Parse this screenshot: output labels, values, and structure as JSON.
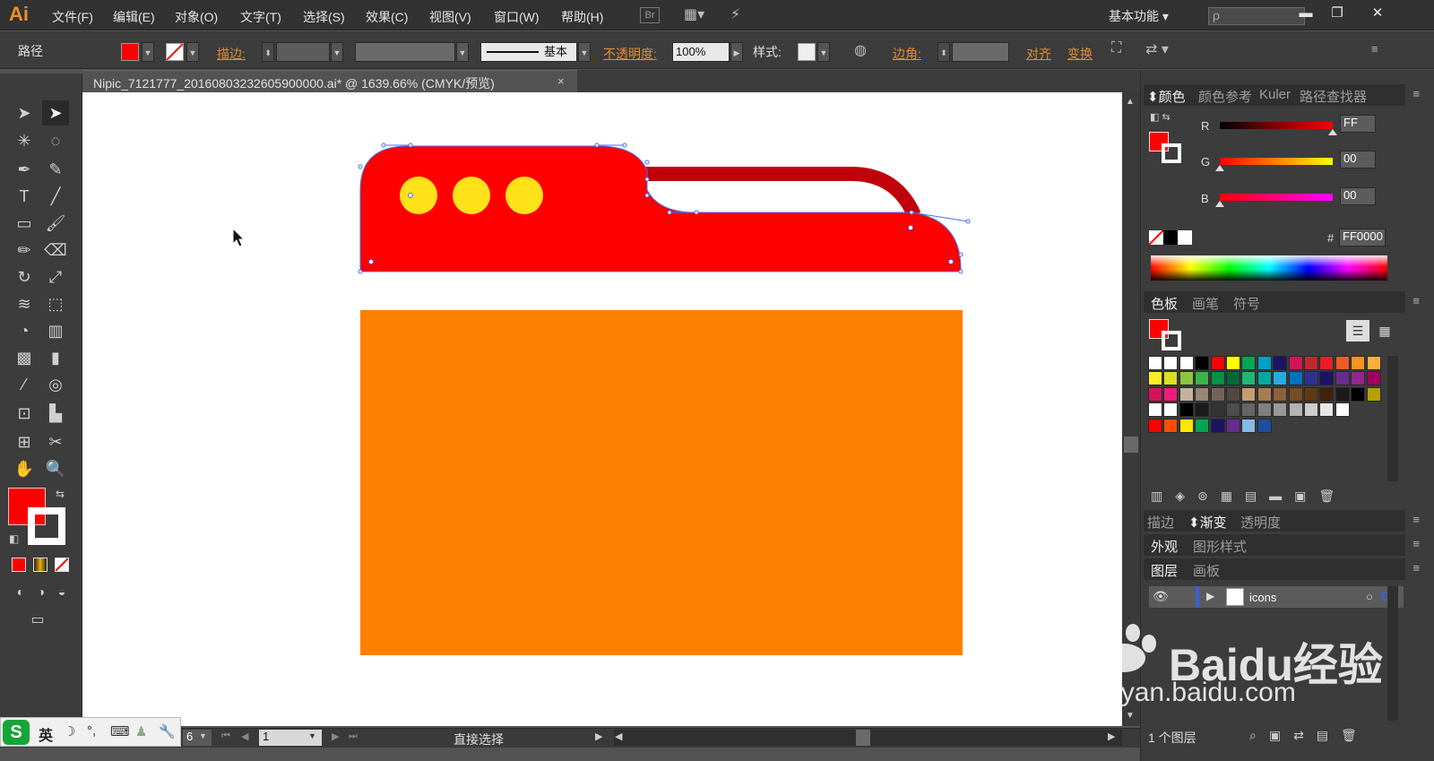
{
  "menubar": {
    "logo": "Ai",
    "items": [
      "文件(F)",
      "编辑(E)",
      "对象(O)",
      "文字(T)",
      "选择(S)",
      "效果(C)",
      "视图(V)",
      "窗口(W)",
      "帮助(H)"
    ],
    "bridge": "Br",
    "workspace": "基本功能",
    "search_placeholder": "ρ"
  },
  "controlbar": {
    "selection_type": "路径",
    "stroke_label": "描边:",
    "stroke_style": "基本",
    "opacity_label": "不透明度:",
    "opacity_value": "100%",
    "style_label": "样式:",
    "corner_label": "边角:",
    "align_label": "对齐",
    "transform_label": "变换"
  },
  "document": {
    "tab_title": "Nipic_7121777_20160803232605900000.ai* @ 1639.66% (CMYK/预览)",
    "close": "×"
  },
  "statusbar": {
    "zoom": "6",
    "page": "1",
    "tool": "直接选择"
  },
  "ime": {
    "logo": "S",
    "lang": "英"
  },
  "color_panel": {
    "tabs": [
      "颜色",
      "颜色参考",
      "Kuler",
      "路径查找器"
    ],
    "r_label": "R",
    "g_label": "G",
    "b_label": "B",
    "r_value": "FF",
    "g_value": "00",
    "b_value": "00",
    "r_level": 1.0,
    "g_level": 0.0,
    "b_level": 0.0,
    "hash_label": "#",
    "hex_value": "FF0000"
  },
  "swatches_panel": {
    "tabs": [
      "色板",
      "画笔",
      "符号"
    ]
  },
  "stroke_panel": {
    "tabs": [
      "描边",
      "渐变",
      "透明度"
    ]
  },
  "appearance_panel": {
    "tabs": [
      "外观",
      "图形样式"
    ]
  },
  "layers_panel": {
    "tabs": [
      "图层",
      "画板"
    ],
    "layer_name": "icons",
    "layer_count": "1 个图层"
  },
  "watermark": {
    "brand": "Baidu经验",
    "url": "jingyan.baidu.com"
  },
  "colors": {
    "fill": "#ff0000",
    "folder_body": "#ff7f00",
    "tab_red": "#ff0000",
    "handle_dark_red": "#c0000b",
    "dots_yellow": "#ffe21a",
    "selection_blue": "#4a6ef0",
    "accent_orange": "#e08c37"
  }
}
